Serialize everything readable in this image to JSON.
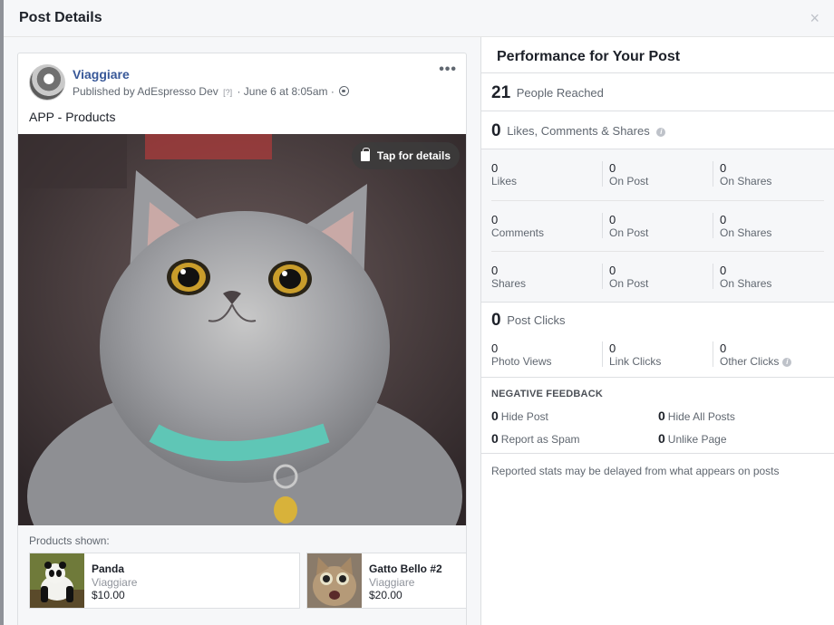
{
  "dialog": {
    "title": "Post Details",
    "close_glyph": "×"
  },
  "post": {
    "page_name": "Viaggiare",
    "published_by_prefix": "Published by",
    "publisher": "AdEspresso Dev",
    "help_marker": "[?]",
    "date": "· June 6 at 8:05am ·",
    "more_glyph": "•••",
    "text": "APP - Products",
    "tap_label": "Tap for details"
  },
  "products": {
    "label": "Products shown:",
    "items": [
      {
        "name": "Panda",
        "shop": "Viaggiare",
        "price": "$10.00"
      },
      {
        "name": "Gatto Bello #2",
        "shop": "Viaggiare",
        "price": "$20.00"
      }
    ]
  },
  "performance": {
    "title": "Performance for Your Post",
    "reach": {
      "value": "21",
      "label": "People Reached"
    },
    "engagement": {
      "value": "0",
      "label": "Likes, Comments & Shares",
      "info": "i"
    },
    "likes": {
      "total": "0",
      "total_label": "Likes",
      "post": "0",
      "post_label": "On Post",
      "shares": "0",
      "shares_label": "On Shares"
    },
    "comments": {
      "total": "0",
      "total_label": "Comments",
      "post": "0",
      "post_label": "On Post",
      "shares": "0",
      "shares_label": "On Shares"
    },
    "share_stats": {
      "total": "0",
      "total_label": "Shares",
      "post": "0",
      "post_label": "On Post",
      "shares": "0",
      "shares_label": "On Shares"
    },
    "clicks": {
      "value": "0",
      "label": "Post Clicks",
      "photo_views": "0",
      "photo_views_label": "Photo Views",
      "link_clicks": "0",
      "link_clicks_label": "Link Clicks",
      "other_clicks": "0",
      "other_clicks_label": "Other Clicks",
      "info": "i"
    },
    "negative": {
      "title": "NEGATIVE FEEDBACK",
      "hide_post": {
        "value": "0",
        "label": "Hide Post"
      },
      "hide_all": {
        "value": "0",
        "label": "Hide All Posts"
      },
      "spam": {
        "value": "0",
        "label": "Report as Spam"
      },
      "unlike": {
        "value": "0",
        "label": "Unlike Page"
      }
    },
    "disclaimer": "Reported stats may be delayed from what appears on posts"
  }
}
